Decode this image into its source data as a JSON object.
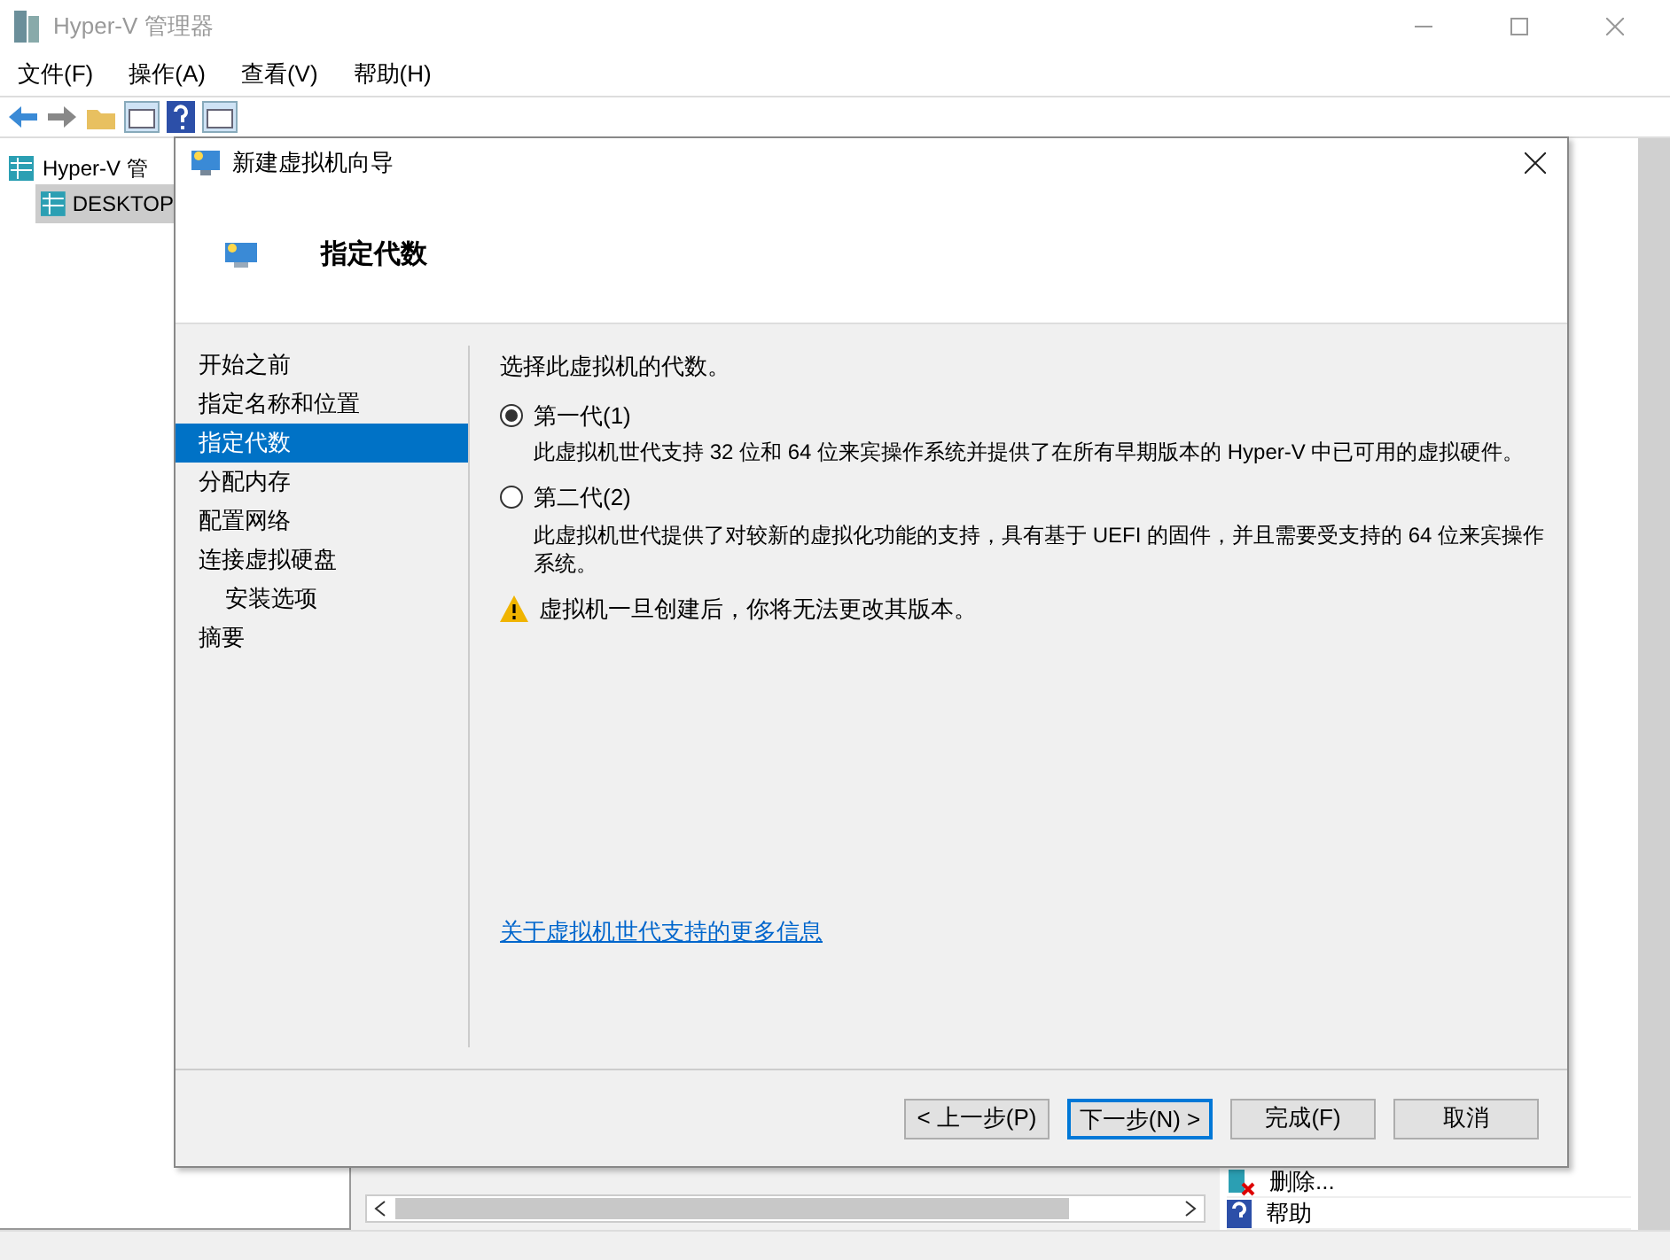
{
  "window": {
    "title": "Hyper-V 管理器"
  },
  "menu": [
    "文件(F)",
    "操作(A)",
    "查看(V)",
    "帮助(H)"
  ],
  "tree": [
    {
      "label": "Hyper-V 管",
      "selected": false,
      "children": [
        {
          "label": "DESKTOP",
          "selected": true
        }
      ]
    }
  ],
  "actions": [
    {
      "label": "删除...",
      "kind": "delete"
    },
    {
      "label": "帮助",
      "kind": "help"
    }
  ],
  "dialog": {
    "title": "新建虚拟机向导",
    "heading": "指定代数",
    "steps": [
      {
        "label": "开始之前",
        "selected": false
      },
      {
        "label": "指定名称和位置",
        "selected": false
      },
      {
        "label": "指定代数",
        "selected": true
      },
      {
        "label": "分配内存",
        "selected": false
      },
      {
        "label": "配置网络",
        "selected": false
      },
      {
        "label": "连接虚拟硬盘",
        "selected": false,
        "children": [
          {
            "label": "安装选项",
            "selected": false
          }
        ]
      },
      {
        "label": "摘要",
        "selected": false
      }
    ],
    "prompt": "选择此虚拟机的代数。",
    "options": [
      {
        "label": "第一代(1)",
        "selected": true,
        "description": "此虚拟机世代支持 32 位和 64 位来宾操作系统并提供了在所有早期版本的 Hyper-V 中已可用的虚拟硬件。"
      },
      {
        "label": "第二代(2)",
        "selected": false,
        "description": "此虚拟机世代提供了对较新的虚拟化功能的支持，具有基于 UEFI 的固件，并且需要受支持的 64 位来宾操作系统。"
      }
    ],
    "warning": "虚拟机一旦创建后，你将无法更改其版本。",
    "link": "关于虚拟机世代支持的更多信息",
    "buttons": [
      {
        "label": "< 上一步(P)",
        "default": false
      },
      {
        "label": "下一步(N) >",
        "default": true
      },
      {
        "label": "完成(F)",
        "default": false
      },
      {
        "label": "取消",
        "default": false
      }
    ]
  }
}
